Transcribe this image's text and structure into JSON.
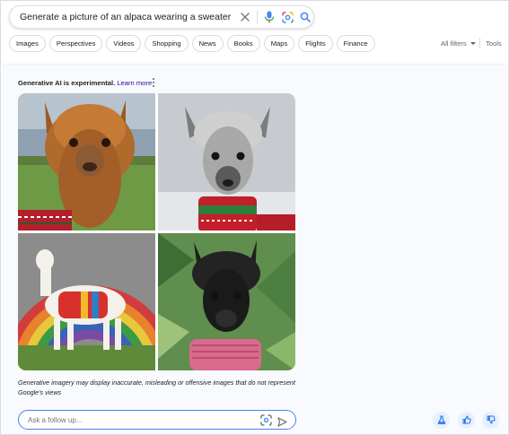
{
  "search": {
    "query": "Generate a picture of an alpaca wearing a sweater"
  },
  "chips": [
    "Images",
    "Perspectives",
    "Videos",
    "Shopping",
    "News",
    "Books",
    "Maps",
    "Flights",
    "Finance"
  ],
  "filters": {
    "all_filters": "All filters",
    "tools": "Tools"
  },
  "ai": {
    "experimental_label": "Generative AI is experimental.",
    "learn_more": "Learn more",
    "disclaimer": "Generative imagery may display inaccurate, misleading or offensive images that do not represent Google's views",
    "followup_placeholder": "Ask a follow up..."
  },
  "icons": {
    "clear": "close-icon",
    "mic": "microphone-icon",
    "lens": "google-lens-icon",
    "search": "search-icon",
    "send": "send-icon",
    "labs": "flask-icon",
    "thumbs_up": "thumbs-up-icon",
    "thumbs_down": "thumbs-down-icon"
  },
  "colors": {
    "accent_blue": "#4285f4",
    "link_blue": "#1a0dab",
    "panel_bg": "#f8fafd",
    "button_bg": "#e8f0fe"
  }
}
